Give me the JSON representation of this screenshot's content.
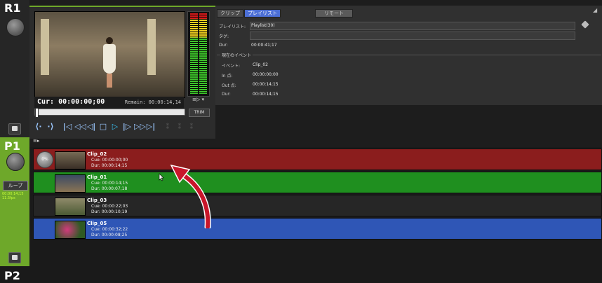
{
  "rail": {
    "r1_label": "R1",
    "p1_label": "P1",
    "p2_label": "P2",
    "loop_label": "ループ",
    "loop_info_line1": "00:00:14;15",
    "loop_info_line2": "11.5fps"
  },
  "player": {
    "cur_text": "Cur: 00:00:00;00",
    "remain_text": "Remain: 00:00:14,14",
    "meter_option": "≡▷ ▾",
    "trim_label": "TRIM"
  },
  "transport": {
    "buttons": [
      "⟨·",
      "·⟩",
      "|◁",
      "◁◁",
      "◁|",
      "□",
      "▷",
      "|▷",
      "▷▷",
      "▷|",
      "⁑",
      "⁑",
      "⁑"
    ]
  },
  "tabs": {
    "clip": "クリップ",
    "playlist": "プレイリスト",
    "remote": "リモート"
  },
  "info": {
    "playlist_label": "プレイリスト:",
    "playlist_value": "Playlist(30)",
    "tag_label": "タグ:",
    "dur_label": "Dur:",
    "dur_value": "00:00:41;17",
    "current_event_title": "現在のイベント",
    "event_label": "イベント:",
    "event_value": "Clip_02",
    "in_label": "In 点:",
    "in_value": "00:00:00;00",
    "out_label": "Out 点:",
    "out_value": "00:00:14;15",
    "event_dur_label": "Dur:",
    "event_dur_value": "00:00:14;15"
  },
  "playlist": {
    "items": [
      {
        "name": "Clip_02",
        "cue": "Cue: 00:00:00;00",
        "dur": "Dur: 00:00:14;15",
        "color": "#8b1d1d",
        "progress": "0%"
      },
      {
        "name": "Clip_01",
        "cue": "Cue: 00:00:14;15",
        "dur": "Dur: 00:00:07;18",
        "color": "#1f8f1f"
      },
      {
        "name": "Clip_03",
        "cue": "Cue: 00:00:22;03",
        "dur": "Dur: 00:00:10;19",
        "color": "#262626"
      },
      {
        "name": "Clip_05",
        "cue": "Cue: 00:00:32;22",
        "dur": "Dur: 00:00:08;25",
        "color": "#2f56b6"
      }
    ]
  },
  "colors": {
    "accent_green": "#6ea82a",
    "tab_active": "#4c6fd6",
    "annotation_arrow": "#c8162a"
  }
}
